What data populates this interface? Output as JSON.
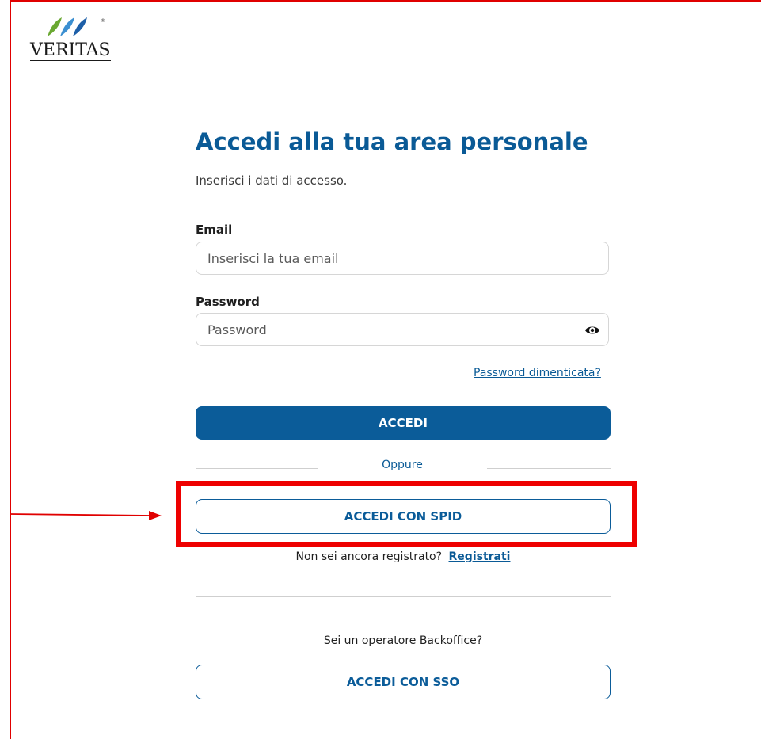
{
  "brand": {
    "name": "VERITAS",
    "registered": "®"
  },
  "colors": {
    "primary": "#0b5c99",
    "highlight": "#ee0000",
    "logo_green": "#6aa832",
    "logo_blue": "#1d6bb5"
  },
  "login": {
    "title": "Accedi alla tua area personale",
    "subtitle": "Inserisci i dati di accesso.",
    "email": {
      "label": "Email",
      "placeholder": "Inserisci la tua email",
      "value": ""
    },
    "password": {
      "label": "Password",
      "placeholder": "Password",
      "value": "",
      "toggle_icon": "eye-icon"
    },
    "forgot_link": "Password dimenticata?",
    "submit_label": "ACCEDI",
    "divider_text": "Oppure",
    "spid_label": "ACCEDI CON SPID",
    "register_prompt": "Non sei ancora registrato?",
    "register_link": "Registrati",
    "operator_prompt": "Sei un operatore Backoffice?",
    "sso_label": "ACCEDI CON SSO"
  }
}
